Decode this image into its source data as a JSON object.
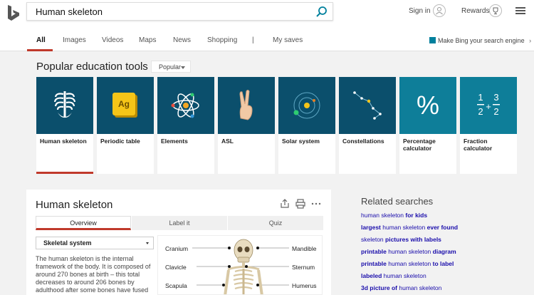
{
  "search": {
    "query": "Human skeleton"
  },
  "header": {
    "signin": "Sign in",
    "rewards": "Rewards"
  },
  "nav": {
    "items": [
      "All",
      "Images",
      "Videos",
      "Maps",
      "News",
      "Shopping",
      "|",
      "My saves"
    ],
    "promo": "Make Bing your search engine"
  },
  "tools": {
    "title": "Popular education tools",
    "filter": "Popular",
    "cards": [
      {
        "label": "Human skeleton",
        "color": "#0b4f6c",
        "icon": "rib-cage-icon"
      },
      {
        "label": "Periodic table",
        "color": "#0b4f6c",
        "icon": "periodic-element-icon",
        "tile_text": "Ag"
      },
      {
        "label": "Elements",
        "color": "#0b4f6c",
        "icon": "atom-icon"
      },
      {
        "label": "ASL",
        "color": "#0b4f6c",
        "icon": "hand-sign-icon"
      },
      {
        "label": "Solar system",
        "color": "#0b4f6c",
        "icon": "orbit-icon"
      },
      {
        "label": "Constellations",
        "color": "#0b4f6c",
        "icon": "constellation-icon"
      },
      {
        "label": "Percentage calculator",
        "color": "#0e7e99",
        "icon": "percent-icon",
        "tile_text": "%"
      },
      {
        "label": "Fraction calculator",
        "color": "#0e7e99",
        "icon": "fraction-icon",
        "tile_text": [
          "1",
          "3",
          "2",
          "2",
          "+"
        ]
      }
    ]
  },
  "answer": {
    "title": "Human skeleton",
    "tabs": [
      "Overview",
      "Label it",
      "Quiz"
    ],
    "select": "Skeletal system",
    "description": "The human skeleton is the internal framework of the body. It is composed of around 270 bones at birth – this total decreases to around 206 bones by adulthood after some bones have fused",
    "diagram_labels": {
      "left": [
        "Cranium",
        "Clavicle",
        "Scapula"
      ],
      "right": [
        "Mandible",
        "Sternum",
        "Humerus"
      ]
    }
  },
  "related": {
    "title": "Related searches",
    "items": [
      [
        "human skeleton ",
        "for kids"
      ],
      [
        "largest ",
        "human skeleton ",
        "ever found"
      ],
      [
        "skeleton ",
        "pictures with labels"
      ],
      [
        "printable ",
        "human skeleton ",
        "diagram"
      ],
      [
        "printable ",
        "human skeleton ",
        "to label"
      ],
      [
        "labeled ",
        "human skeleton"
      ],
      [
        "3d picture of ",
        "human skeleton"
      ]
    ],
    "bold_map": [
      [
        false,
        true
      ],
      [
        true,
        false,
        true
      ],
      [
        false,
        true
      ],
      [
        true,
        false,
        true
      ],
      [
        true,
        false,
        true
      ],
      [
        true,
        false
      ],
      [
        true,
        false
      ]
    ]
  }
}
